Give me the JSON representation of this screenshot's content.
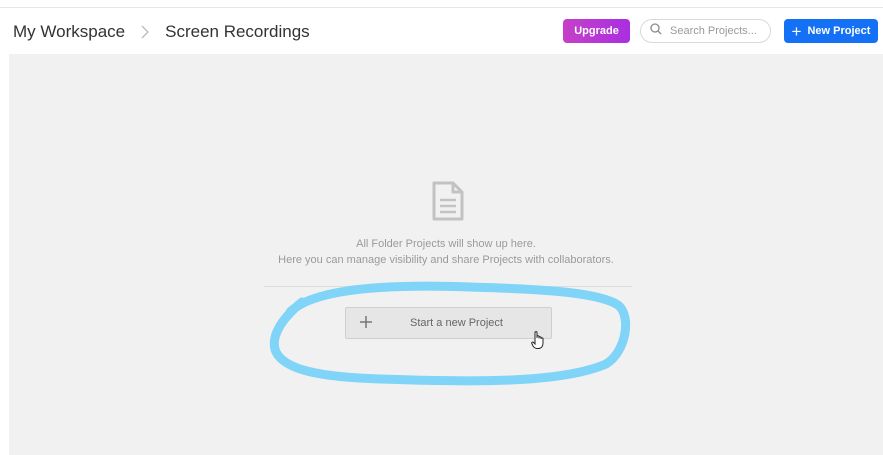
{
  "breadcrumb": {
    "workspace": "My Workspace",
    "current": "Screen Recordings"
  },
  "header": {
    "upgrade_label": "Upgrade",
    "search_placeholder": "Search Projects...",
    "new_project_label": "New Project"
  },
  "empty_state": {
    "line1": "All Folder Projects will show up here.",
    "line2": "Here you can manage visibility and share Projects with collaborators.",
    "start_button_label": "Start a new Project"
  },
  "colors": {
    "upgrade": "#b836d6",
    "primary": "#1470f5",
    "annotation": "#7fd4f8"
  }
}
